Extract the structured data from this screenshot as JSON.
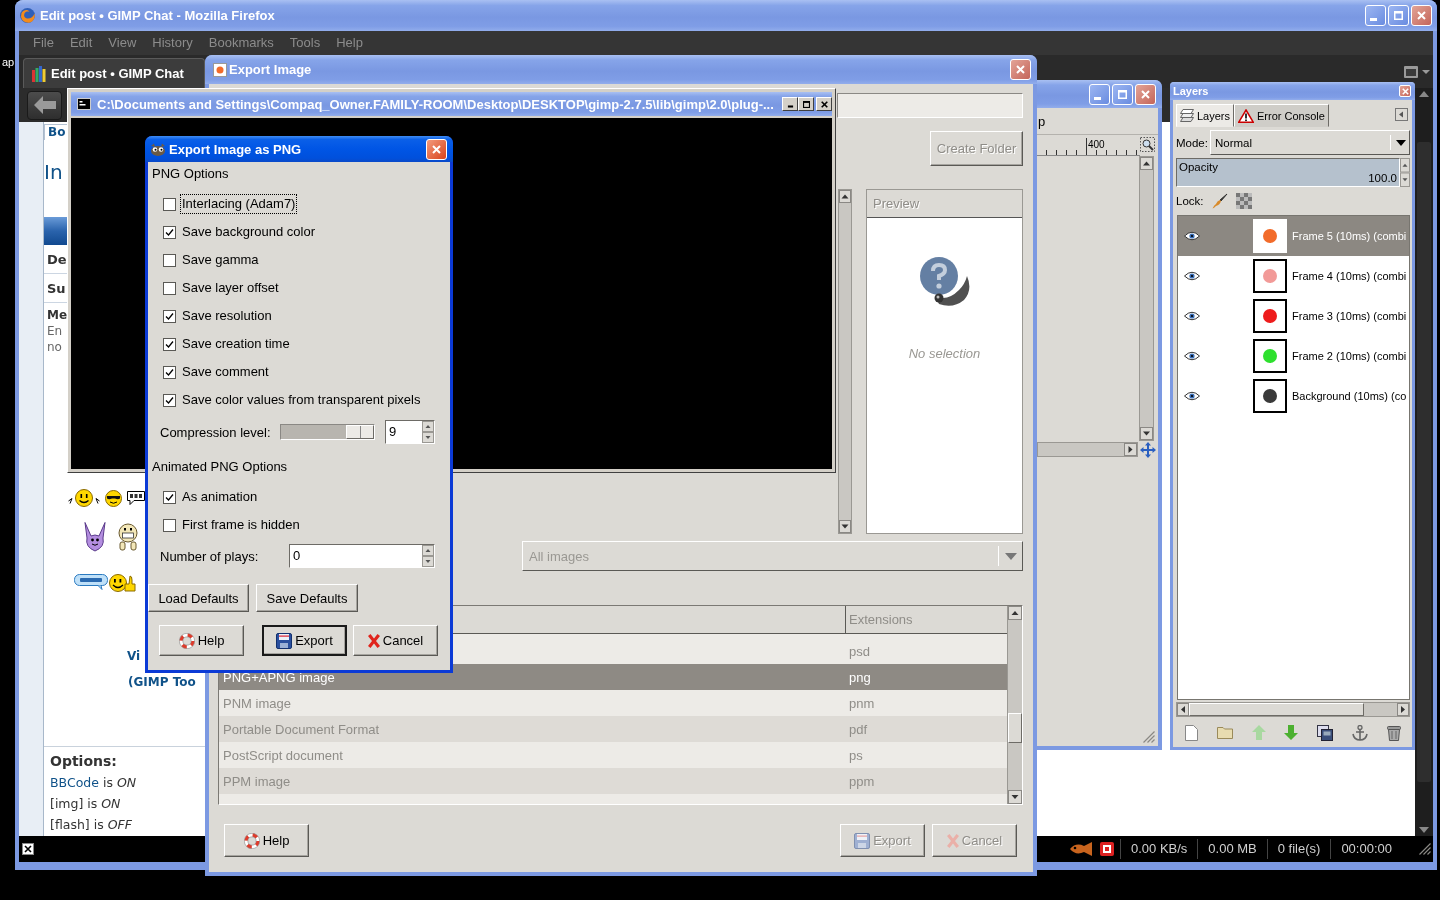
{
  "desktop": {
    "text": "ap"
  },
  "firefox": {
    "title": "Edit post • GIMP Chat - Mozilla Firefox",
    "menu": [
      "File",
      "Edit",
      "View",
      "History",
      "Bookmarks",
      "Tools",
      "Help"
    ],
    "tab": "Edit post • GIMP Chat",
    "page": {
      "nav_tab": "Bo",
      "heading": "In",
      "rows": [
        "De",
        "Su"
      ],
      "message": {
        "label": "Me",
        "lines": [
          "En",
          "no"
        ]
      },
      "links": [
        "Vi",
        "(GIMP Too"
      ],
      "options": {
        "title": "Options:",
        "items": [
          {
            "kind": "link",
            "link": "BBCode",
            "text": "is *ON*"
          },
          {
            "kind": "plain",
            "text": "[img] is *ON*"
          },
          {
            "kind": "plain",
            "text": "[flash] is *OFF*"
          }
        ]
      }
    },
    "status_bar": [
      "0.00 KB/s",
      "0.00 MB",
      "0 file(s)",
      "00:00:00"
    ]
  },
  "image_window": {
    "menu_fragment": "p",
    "ruler_label": "400"
  },
  "export_dialog": {
    "title": "Export Image",
    "create_folder": {
      "label": "Create Folder",
      "disabled": true
    },
    "preview": {
      "title": "Preview",
      "empty_text": "No selection"
    },
    "file_filter": {
      "value": "All images",
      "disabled": true
    },
    "file_types": {
      "extension_header": "Extensions",
      "rows": [
        {
          "extension": "psd",
          "selected": false
        },
        {
          "name": "PNG+APNG image",
          "extension": "png",
          "selected": true
        },
        {
          "name": "PNM image",
          "extension": "pnm",
          "selected": false
        },
        {
          "name": "Portable Document Format",
          "extension": "pdf",
          "selected": false
        },
        {
          "name": "PostScript document",
          "extension": "ps",
          "selected": false
        },
        {
          "name": "PPM image",
          "extension": "ppm",
          "selected": false
        }
      ]
    },
    "buttons": [
      {
        "label": "Help",
        "kind": "help",
        "disabled": false
      },
      {
        "label": "Export",
        "kind": "export",
        "disabled": true
      },
      {
        "label": "Cancel",
        "kind": "cancel",
        "disabled": true
      }
    ]
  },
  "console": {
    "title": "C:\\Documents and Settings\\Compaq_Owner.FAMILY-ROOM\\Desktop\\DESKTOP\\gimp-2.7.5\\lib\\gimp\\2.0\\plug-..."
  },
  "png_dialog": {
    "title": "Export Image as PNG",
    "png_options_title": "PNG Options",
    "options": [
      {
        "label": "Interlacing (Adam7)",
        "checked": false,
        "focused": true
      },
      {
        "label": "Save background color",
        "checked": true,
        "focused": false
      },
      {
        "label": "Save gamma",
        "checked": false,
        "focused": false
      },
      {
        "label": "Save layer offset",
        "checked": false,
        "focused": false
      },
      {
        "label": "Save resolution",
        "checked": true,
        "focused": false
      },
      {
        "label": "Save creation time",
        "checked": true,
        "focused": false
      },
      {
        "label": "Save comment",
        "checked": true,
        "focused": false
      },
      {
        "label": "Save color values from transparent pixels",
        "checked": true,
        "focused": false
      }
    ],
    "compression": {
      "label": "Compression level:",
      "level": 1,
      "value": "9"
    },
    "animated_title": "Animated PNG Options",
    "animated_options": [
      {
        "label": "As animation",
        "checked": true
      },
      {
        "label": "First frame is hidden",
        "checked": false
      }
    ],
    "plays": {
      "label": "Number of plays:",
      "value": "0"
    },
    "defaults_buttons": [
      "Load Defaults",
      "Save Defaults"
    ],
    "buttons": [
      {
        "label": "Help",
        "kind": "help",
        "default": false
      },
      {
        "label": "Export",
        "kind": "export",
        "default": true
      },
      {
        "label": "Cancel",
        "kind": "cancel",
        "default": false
      }
    ]
  },
  "layers_panel": {
    "title": "Layers",
    "tabs": [
      {
        "label": "Layers",
        "kind": "layers",
        "selected": true
      },
      {
        "label": "Error Console",
        "kind": "console",
        "selected": false
      }
    ],
    "mode": {
      "label": "Mode:",
      "value": "Normal"
    },
    "opacity": {
      "label": "Opacity",
      "value": "100.0",
      "level": 1
    },
    "lock_label": "Lock:",
    "layers": [
      {
        "name": "Frame 5 (10ms) (combi",
        "color": "#f26b2a",
        "selected": true,
        "visible": true
      },
      {
        "name": "Frame 4 (10ms) (combi",
        "color": "#f29a98",
        "selected": false,
        "visible": true
      },
      {
        "name": "Frame 3 (10ms) (combi",
        "color": "#ee1c1c",
        "selected": false,
        "visible": true
      },
      {
        "name": "Frame 2 (10ms) (combi",
        "color": "#2ee02e",
        "selected": false,
        "visible": true
      },
      {
        "name": "Background (10ms) (co",
        "color": "#3a3a3a",
        "selected": false,
        "visible": true
      }
    ]
  }
}
